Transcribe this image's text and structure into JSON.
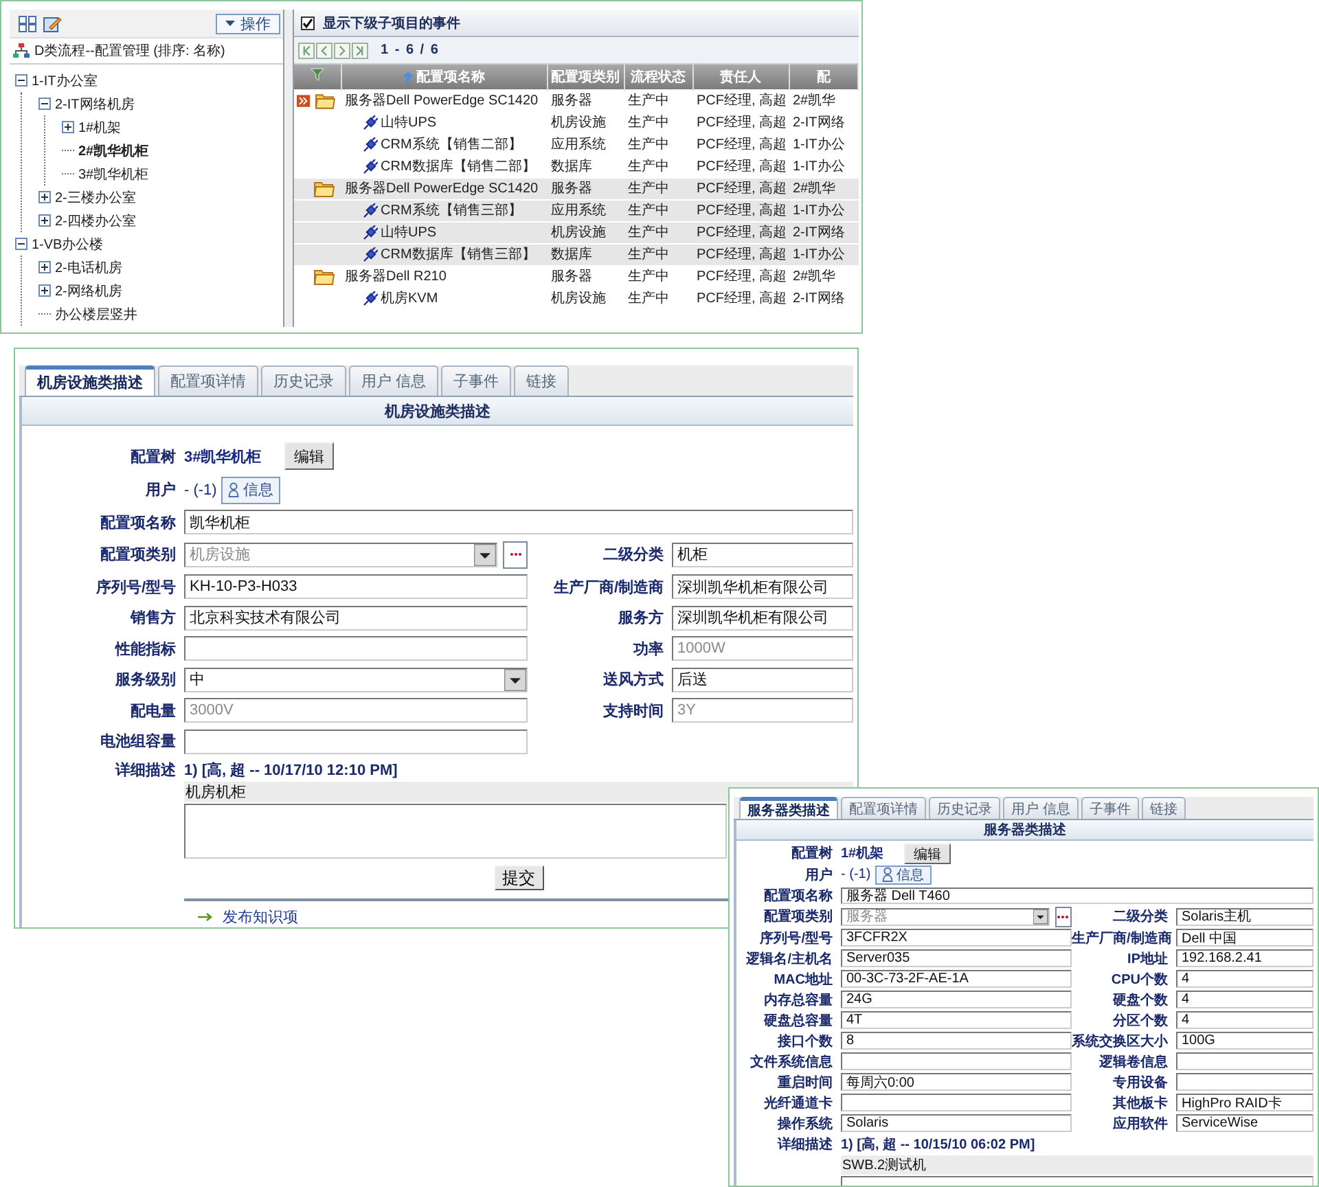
{
  "tree_pane": {
    "action_button": "操作",
    "title": "D类流程--配置管理 (排序: 名称)",
    "items": [
      {
        "label": "1-IT办公室",
        "kind": "branch",
        "expanded": true,
        "selected": false,
        "children": [
          {
            "label": "2-IT网络机房",
            "kind": "branch",
            "expanded": true,
            "selected": false,
            "children": [
              {
                "label": "1#机架",
                "kind": "branch",
                "expanded": false,
                "selected": false
              },
              {
                "label": "2#凯华机柜",
                "kind": "leaf",
                "selected": true
              },
              {
                "label": "3#凯华机柜",
                "kind": "leaf",
                "selected": false
              }
            ]
          },
          {
            "label": "2-三楼办公室",
            "kind": "branch",
            "expanded": false,
            "selected": false
          },
          {
            "label": "2-四楼办公室",
            "kind": "branch",
            "expanded": false,
            "selected": false
          }
        ]
      },
      {
        "label": "1-VB办公楼",
        "kind": "branch",
        "expanded": true,
        "selected": false,
        "children": [
          {
            "label": "2-电话机房",
            "kind": "branch",
            "expanded": false,
            "selected": false
          },
          {
            "label": "2-网络机房",
            "kind": "branch",
            "expanded": false,
            "selected": false
          },
          {
            "label": "办公楼层竖井",
            "kind": "leaf",
            "selected": false
          }
        ]
      }
    ]
  },
  "events_pane": {
    "show_child_events": {
      "label": "显示下级子项目的事件",
      "checked": true
    },
    "pager": "1 - 6 / 6",
    "columns": [
      {
        "label": "配置项名称",
        "sorted": true
      },
      {
        "label": "配置项类别",
        "sorted": false
      },
      {
        "label": "流程状态",
        "sorted": false
      },
      {
        "label": "责任人",
        "sorted": false
      },
      {
        "label": "配",
        "sorted": false
      }
    ],
    "rows": [
      {
        "kind": "parent",
        "marked": true,
        "shaded": false,
        "cells": [
          "服务器Dell PowerEdge SC1420",
          "服务器",
          "生产中",
          "PCF经理, 高超",
          "2#凯华"
        ]
      },
      {
        "kind": "child",
        "marked": false,
        "shaded": false,
        "cells": [
          "山特UPS",
          "机房设施",
          "生产中",
          "PCF经理, 高超",
          "2-IT网络"
        ]
      },
      {
        "kind": "child",
        "marked": false,
        "shaded": false,
        "cells": [
          "CRM系统【销售二部】",
          "应用系统",
          "生产中",
          "PCF经理, 高超",
          "1-IT办公"
        ]
      },
      {
        "kind": "child",
        "marked": false,
        "shaded": false,
        "cells": [
          "CRM数据库【销售二部】",
          "数据库",
          "生产中",
          "PCF经理, 高超",
          "1-IT办公"
        ]
      },
      {
        "kind": "parent",
        "marked": false,
        "shaded": true,
        "cells": [
          "服务器Dell PowerEdge SC1420",
          "服务器",
          "生产中",
          "PCF经理, 高超",
          "2#凯华"
        ]
      },
      {
        "kind": "child",
        "marked": false,
        "shaded": true,
        "cells": [
          "CRM系统【销售三部】",
          "应用系统",
          "生产中",
          "PCF经理, 高超",
          "1-IT办公"
        ]
      },
      {
        "kind": "child",
        "marked": false,
        "shaded": true,
        "cells": [
          "山特UPS",
          "机房设施",
          "生产中",
          "PCF经理, 高超",
          "2-IT网络"
        ]
      },
      {
        "kind": "child",
        "marked": false,
        "shaded": true,
        "cells": [
          "CRM数据库【销售三部】",
          "数据库",
          "生产中",
          "PCF经理, 高超",
          "1-IT办公"
        ]
      },
      {
        "kind": "parent",
        "marked": false,
        "shaded": false,
        "cells": [
          "服务器Dell R210",
          "服务器",
          "生产中",
          "PCF经理, 高超",
          "2#凯华"
        ]
      },
      {
        "kind": "child",
        "marked": false,
        "shaded": false,
        "cells": [
          "机房KVM",
          "机房设施",
          "生产中",
          "PCF经理, 高超",
          "2-IT网络"
        ]
      }
    ]
  },
  "detail_panel": {
    "tabs": [
      {
        "label": "机房设施类描述",
        "selected": true
      },
      {
        "label": "配置项详情",
        "selected": false
      },
      {
        "label": "历史记录",
        "selected": false
      },
      {
        "label": "用户 信息",
        "selected": false
      },
      {
        "label": "子事件",
        "selected": false
      },
      {
        "label": "链接",
        "selected": false
      }
    ],
    "section_title": "机房设施类描述",
    "config_tree": {
      "label": "配置树",
      "value": "3#凯华机柜",
      "button": "编辑"
    },
    "user": {
      "label": "用户",
      "value": "- (-1)",
      "button": "信息"
    },
    "rows": [
      {
        "left": {
          "kind": "wide_text",
          "label": "配置项名称",
          "value": "凯华机柜",
          "disabled": false
        }
      },
      {
        "left": {
          "kind": "select_picker",
          "label": "配置项类别",
          "value": "机房设施",
          "disabled": true
        },
        "right": {
          "kind": "text",
          "label": "二级分类",
          "value": "机柜",
          "disabled": false
        }
      },
      {
        "left": {
          "kind": "text",
          "label": "序列号/型号",
          "value": "KH-10-P3-H033",
          "disabled": false
        },
        "right": {
          "kind": "text",
          "label": "生产厂商/制造商",
          "value": "深圳凯华机柜有限公司",
          "disabled": false
        }
      },
      {
        "left": {
          "kind": "text",
          "label": "销售方",
          "value": "北京科实技术有限公司",
          "disabled": false
        },
        "right": {
          "kind": "text",
          "label": "服务方",
          "value": "深圳凯华机柜有限公司",
          "disabled": false
        }
      },
      {
        "left": {
          "kind": "text",
          "label": "性能指标"
        },
        "right": {
          "kind": "text",
          "label": "功率",
          "value": "1000W",
          "disabled": true
        }
      },
      {
        "left": {
          "kind": "select",
          "label": "服务级别",
          "value": "中",
          "disabled": false
        },
        "right": {
          "kind": "text",
          "label": "送风方式",
          "value": "后送",
          "disabled": false
        }
      },
      {
        "left": {
          "kind": "text",
          "label": "配电量",
          "value": "3000V",
          "disabled": true
        },
        "right": {
          "kind": "text",
          "label": "支持时间",
          "value": "3Y",
          "disabled": true
        }
      },
      {
        "left": {
          "kind": "text",
          "label": "电池组容量"
        }
      }
    ],
    "description": {
      "label": "详细描述",
      "entry": "1) [高, 超  -- 10/17/10 12:10 PM]",
      "content": "机房机柜",
      "submit": "提交",
      "link": "发布知识项"
    }
  },
  "server_panel": {
    "tabs": [
      {
        "label": "服务器类描述",
        "selected": true
      },
      {
        "label": "配置项详情",
        "selected": false
      },
      {
        "label": "历史记录",
        "selected": false
      },
      {
        "label": "用户 信息",
        "selected": false
      },
      {
        "label": "子事件",
        "selected": false
      },
      {
        "label": "链接",
        "selected": false
      }
    ],
    "section_title": "服务器类描述",
    "config_tree": {
      "label": "配置树",
      "value": "1#机架",
      "button": "编辑"
    },
    "user": {
      "label": "用户",
      "value": "- (-1)",
      "button": "信息"
    },
    "rows": [
      {
        "left": {
          "kind": "wide_text",
          "label": "配置项名称",
          "value": "服务器 Dell T460",
          "disabled": false
        }
      },
      {
        "left": {
          "kind": "select_picker",
          "label": "配置项类别",
          "value": "服务器",
          "disabled": true
        },
        "right": {
          "kind": "text",
          "label": "二级分类",
          "value": "Solaris主机",
          "disabled": false
        }
      },
      {
        "left": {
          "kind": "text",
          "label": "序列号/型号",
          "value": "3FCFR2X",
          "disabled": false
        },
        "right": {
          "kind": "text",
          "label": "生产厂商/制造商",
          "value": "Dell 中国",
          "disabled": false
        }
      },
      {
        "left": {
          "kind": "text",
          "label": "逻辑名/主机名",
          "value": "Server035",
          "disabled": false
        },
        "right": {
          "kind": "text",
          "label": "IP地址",
          "value": "192.168.2.41",
          "disabled": false
        }
      },
      {
        "left": {
          "kind": "text",
          "label": "MAC地址",
          "value": "00-3C-73-2F-AE-1A",
          "disabled": false
        },
        "right": {
          "kind": "text",
          "label": "CPU个数",
          "value": "4",
          "disabled": false
        }
      },
      {
        "left": {
          "kind": "text",
          "label": "内存总容量",
          "value": "24G",
          "disabled": false
        },
        "right": {
          "kind": "text",
          "label": "硬盘个数",
          "value": "4",
          "disabled": false
        }
      },
      {
        "left": {
          "kind": "text",
          "label": "硬盘总容量",
          "value": "4T",
          "disabled": false
        },
        "right": {
          "kind": "text",
          "label": "分区个数",
          "value": "4",
          "disabled": false
        }
      },
      {
        "left": {
          "kind": "text",
          "label": "接口个数",
          "value": "8",
          "disabled": false
        },
        "right": {
          "kind": "text",
          "label": "系统交换区大小",
          "value": "100G",
          "disabled": false
        }
      },
      {
        "left": {
          "kind": "text",
          "label": "文件系统信息"
        },
        "right": {
          "kind": "text",
          "label": "逻辑卷信息"
        }
      },
      {
        "left": {
          "kind": "text",
          "label": "重启时间",
          "value": "每周六0:00",
          "disabled": false
        },
        "right": {
          "kind": "text",
          "label": "专用设备"
        }
      },
      {
        "left": {
          "kind": "text",
          "label": "光纤通道卡"
        },
        "right": {
          "kind": "text",
          "label": "其他板卡",
          "value": "HighPro RAID卡",
          "disabled": false
        }
      },
      {
        "left": {
          "kind": "text",
          "label": "操作系统",
          "value": "Solaris",
          "disabled": false
        },
        "right": {
          "kind": "text",
          "label": "应用软件",
          "value": "ServiceWise",
          "disabled": false
        }
      }
    ],
    "description": {
      "label": "详细描述",
      "entry": "1) [高, 超  -- 10/15/10 06:02 PM]",
      "content": "SWB.2测试机"
    }
  }
}
